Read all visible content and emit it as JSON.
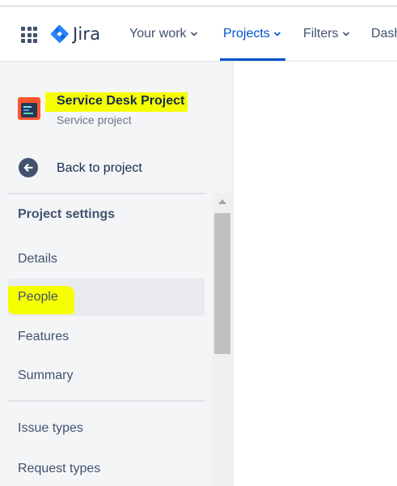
{
  "app": {
    "logo_text": "Jira"
  },
  "nav": {
    "your_work": "Your work",
    "projects": "Projects",
    "filters": "Filters",
    "dashboards_partial": "Dash"
  },
  "project": {
    "name": "Service Desk Project",
    "type": "Service project"
  },
  "back_link": "Back to project",
  "settings": {
    "title": "Project settings",
    "items": [
      "Details",
      "People",
      "Features",
      "Summary"
    ],
    "selected": "People"
  },
  "more_items": [
    "Issue types",
    "Request types"
  ],
  "colors": {
    "accent": "#0052cc",
    "highlight": "#f6ff00",
    "sidebar_bg": "#f4f5f7",
    "text": "#172b4d"
  },
  "icons": {
    "app_switcher": "grid-icon",
    "logo": "jira-logo-icon",
    "back": "arrow-left-circle-icon",
    "project": "service-desk-project-icon"
  }
}
